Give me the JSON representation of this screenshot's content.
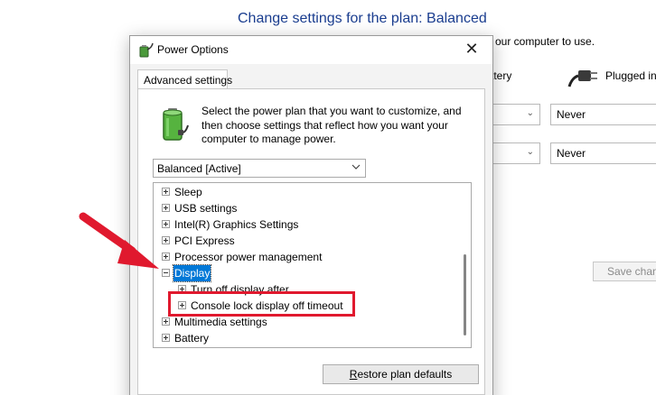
{
  "background": {
    "title": "Change settings for the plan: Balanced",
    "subtitle": "our computer to use.",
    "col_battery": "ttery",
    "col_plugged": "Plugged in",
    "row1_plugged_value": "Never",
    "row2_plugged_value": "Never",
    "save_button": "Save chan"
  },
  "dialog": {
    "title": "Power Options",
    "close_glyph": "✕",
    "tab_label": "Advanced settings",
    "description": "Select the power plan that you want to customize, and then choose settings that reflect how you want your computer to manage power.",
    "plan_select_value": "Balanced [Active]",
    "tree": [
      {
        "label": "Sleep",
        "expander": "plus",
        "indent": 0
      },
      {
        "label": "USB settings",
        "expander": "plus",
        "indent": 0
      },
      {
        "label": "Intel(R) Graphics Settings",
        "expander": "plus",
        "indent": 0
      },
      {
        "label": "PCI Express",
        "expander": "plus",
        "indent": 0
      },
      {
        "label": "Processor power management",
        "expander": "plus",
        "indent": 0
      },
      {
        "label": "Display",
        "expander": "minus",
        "indent": 0,
        "selected": true
      },
      {
        "label": "Turn off display after",
        "expander": "plus",
        "indent": 1
      },
      {
        "label": "Console lock display off timeout",
        "expander": "plus",
        "indent": 1
      },
      {
        "label": "Multimedia settings",
        "expander": "plus",
        "indent": 0
      },
      {
        "label": "Battery",
        "expander": "plus",
        "indent": 0
      }
    ],
    "restore_button_prefix": "R",
    "restore_button_rest": "estore plan defaults"
  },
  "colors": {
    "title_blue": "#1a3d8f",
    "selection_blue": "#0078d7",
    "annotation_red": "#e0192e"
  }
}
